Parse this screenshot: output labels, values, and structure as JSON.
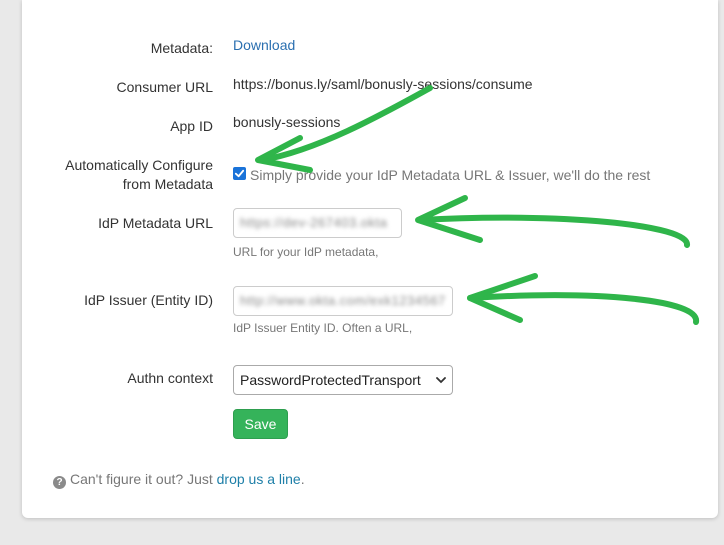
{
  "form": {
    "metadata": {
      "label": "Metadata:",
      "link": "Download"
    },
    "consumer_url": {
      "label": "Consumer URL",
      "value": "https://bonus.ly/saml/bonusly-sessions/consume"
    },
    "app_id": {
      "label": "App ID",
      "value": "bonusly-sessions"
    },
    "auto_config": {
      "label_line1": "Automatically Configure",
      "label_line2": "from Metadata",
      "checked": true,
      "text": "Simply provide your IdP Metadata URL & Issuer, we'll do the rest"
    },
    "idp_metadata_url": {
      "label": "IdP Metadata URL",
      "value": "https://dev-267403.okta",
      "help": "URL for your IdP metadata,"
    },
    "idp_issuer": {
      "label": "IdP Issuer (Entity ID)",
      "value": "http://www.okta.com/exk1234567",
      "help": "IdP Issuer Entity ID. Often a URL,"
    },
    "authn_context": {
      "label": "Authn context",
      "selected": "PasswordProtectedTransport"
    },
    "save_label": "Save"
  },
  "footer": {
    "prefix": "Can't figure it out? Just ",
    "link": "drop us a line",
    "suffix": "."
  },
  "colors": {
    "accent_blue": "#1a73d9",
    "save_green": "#35b35a",
    "annotation_green": "#2fb54a",
    "link": "#2a6fb0"
  },
  "icons": {
    "checkbox_check": "check-icon",
    "select_arrow": "chevron-down-icon",
    "help": "question-circle-icon",
    "annotation": "arrow-annotation-icon"
  }
}
